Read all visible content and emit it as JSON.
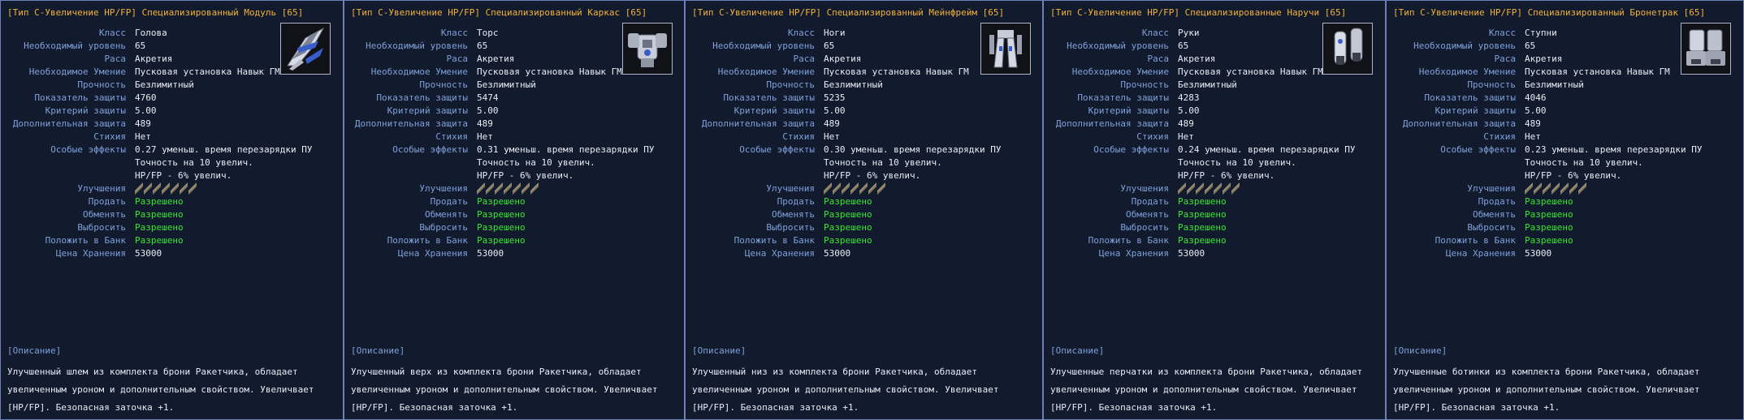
{
  "labels": {
    "class": "Класс",
    "required_level": "Необходимый уровень",
    "race": "Раса",
    "required_skill": "Необходимое Умение",
    "durability": "Прочность",
    "defense": "Показатель защиты",
    "defense_criterion": "Критерий защиты",
    "extra_defense": "Дополнительная защита",
    "element": "Стихия",
    "special_effects": "Особые эффекты",
    "upgrades": "Улучшения",
    "sell": "Продать",
    "trade": "Обменять",
    "discard": "Выбросить",
    "bank": "Положить в Банк",
    "storage_price": "Цена Хранения",
    "description": "[Описание]"
  },
  "panels": [
    {
      "title": "[Тип С-Увеличение HP/FP] Специализированный Модуль [65]",
      "class": "Голова",
      "level": "65",
      "race": "Акретия",
      "skill": "Пусковая установка Навык ГМ",
      "durability": "Безлимитный",
      "defense": "4760",
      "criterion": "5.00",
      "extra": "489",
      "element": "Нет",
      "effect1": "0.27 уменьш. время перезарядки ПУ",
      "effect2": "Точность на 10 увелич.",
      "effect3": "HP/FP - 6% увелич.",
      "sell": "Разрешено",
      "trade": "Разрешено",
      "discard": "Разрешено",
      "bank": "Разрешено",
      "price": "53000",
      "desc": "Улучшенный шлем из комплекта брони Ракетчика, обладает увеличенным уроном и дополнительным свойством. Увеличвает [HP/FP]. Безопасная заточка +1.",
      "icon": "helmet-armor-icon"
    },
    {
      "title": "[Тип С-Увеличение HP/FP] Специализированный Каркас [65]",
      "class": "Торс",
      "level": "65",
      "race": "Акретия",
      "skill": "Пусковая установка Навык ГМ",
      "durability": "Безлимитный",
      "defense": "5474",
      "criterion": "5.00",
      "extra": "489",
      "element": "Нет",
      "effect1": "0.31 уменьш. время перезарядки ПУ",
      "effect2": "Точность на 10 увелич.",
      "effect3": "HP/FP - 6% увелич.",
      "sell": "Разрешено",
      "trade": "Разрешено",
      "discard": "Разрешено",
      "bank": "Разрешено",
      "price": "53000",
      "desc": "Улучшенный верх из комплекта брони Ракетчика, обладает увеличенным уроном и дополнительным свойством. Увеличвает [HP/FP]. Безопасная заточка +1.",
      "icon": "torso-armor-icon"
    },
    {
      "title": "[Тип С-Увеличение HP/FP] Специализированный Мейнфрейм [65]",
      "class": "Ноги",
      "level": "65",
      "race": "Акретия",
      "skill": "Пусковая установка Навык ГМ",
      "durability": "Безлимитный",
      "defense": "5235",
      "criterion": "5.00",
      "extra": "489",
      "element": "Нет",
      "effect1": "0.30 уменьш. время перезарядки ПУ",
      "effect2": "Точность на 10 увелич.",
      "effect3": "HP/FP - 6% увелич.",
      "sell": "Разрешено",
      "trade": "Разрешено",
      "discard": "Разрешено",
      "bank": "Разрешено",
      "price": "53000",
      "desc": "Улучшенный низ из комплекта брони Ракетчика, обладает увеличенным уроном и дополнительным свойством. Увеличвает [HP/FP]. Безопасная заточка +1.",
      "icon": "legs-armor-icon"
    },
    {
      "title": "[Тип С-Увеличение HP/FP] Специализированные Наручи [65]",
      "class": "Руки",
      "level": "65",
      "race": "Акретия",
      "skill": "Пусковая установка Навык ГМ",
      "durability": "Безлимитный",
      "defense": "4283",
      "criterion": "5.00",
      "extra": "489",
      "element": "Нет",
      "effect1": "0.24 уменьш. время перезарядки ПУ",
      "effect2": "Точность на 10 увелич.",
      "effect3": "HP/FP - 6% увелич.",
      "sell": "Разрешено",
      "trade": "Разрешено",
      "discard": "Разрешено",
      "bank": "Разрешено",
      "price": "53000",
      "desc": "Улучшенные перчатки из комплекта брони Ракетчика, обладает увеличенным уроном и дополнительным свойством. Увеличвает [HP/FP]. Безопасная заточка +1.",
      "icon": "gauntlets-armor-icon"
    },
    {
      "title": "[Тип С-Увеличение HP/FP] Специализированный Бронетрак [65]",
      "class": "Ступни",
      "level": "65",
      "race": "Акретия",
      "skill": "Пусковая установка Навык ГМ",
      "durability": "Безлимитный",
      "defense": "4046",
      "criterion": "5.00",
      "extra": "489",
      "element": "Нет",
      "effect1": "0.23 уменьш. время перезарядки ПУ",
      "effect2": "Точность на 10 увелич.",
      "effect3": "HP/FP - 6% увелич.",
      "sell": "Разрешено",
      "trade": "Разрешено",
      "discard": "Разрешено",
      "bank": "Разрешено",
      "price": "53000",
      "desc": "Улучшенные ботинки из комплекта брони Ракетчика, обладает увеличенным уроном и дополнительным свойством. Увеличвает [HP/FP]. Безопасная заточка +1.",
      "icon": "boots-armor-icon"
    }
  ],
  "colors": {
    "title": "#f2b23a",
    "label": "#7fa0d8",
    "value": "#e8ecf4",
    "allowed": "#38e832",
    "border": "#6f80b8",
    "background": "#121a2e"
  }
}
